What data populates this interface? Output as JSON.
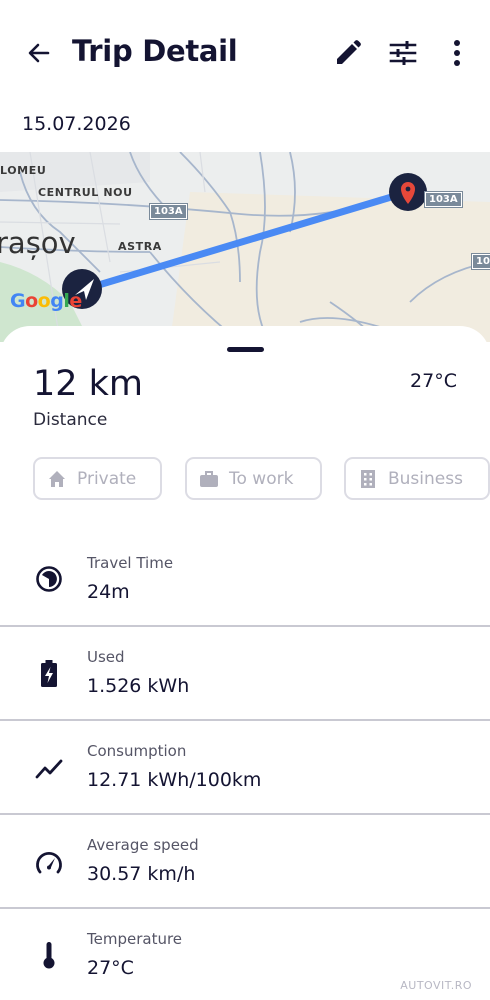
{
  "header": {
    "title": "Trip Detail",
    "back_icon": "arrow-left-icon",
    "edit_icon": "pencil-icon",
    "filter_icon": "sliders-icon",
    "more_icon": "more-vertical-icon"
  },
  "date": "15.07.2026",
  "map": {
    "labels": {
      "district_1": "LOMEU",
      "district_2": "CENTRUL NOU",
      "district_3": "ASTRA",
      "city": "rașov",
      "road_1": "103A",
      "road_2": "103A",
      "road_3": "103"
    },
    "logo": "Google",
    "route_color": "#4a8af4",
    "destination_pin_color": "#e5483a"
  },
  "trip": {
    "distance": "12 km",
    "distance_label": "Distance",
    "temperature": "27°C"
  },
  "categories": [
    {
      "label": "Private",
      "icon": "home-icon"
    },
    {
      "label": "To work",
      "icon": "briefcase-icon"
    },
    {
      "label": "Business",
      "icon": "building-icon"
    }
  ],
  "stats": [
    {
      "label": "Travel Time",
      "value": "24m",
      "icon": "timer-icon"
    },
    {
      "label": "Used",
      "value": "1.526 kWh",
      "icon": "battery-charging-icon"
    },
    {
      "label": "Consumption",
      "value": "12.71 kWh/100km",
      "icon": "trend-line-icon"
    },
    {
      "label": "Average speed",
      "value": "30.57 km/h",
      "icon": "speedometer-icon"
    },
    {
      "label": "Temperature",
      "value": "27°C",
      "icon": "thermometer-icon"
    }
  ],
  "watermark": "AUTOVIT.RO",
  "colors": {
    "primary_dark": "#141432",
    "chip_border": "#dcdce4",
    "chip_text": "#b0b0bc",
    "divider": "#c9c9d2"
  }
}
